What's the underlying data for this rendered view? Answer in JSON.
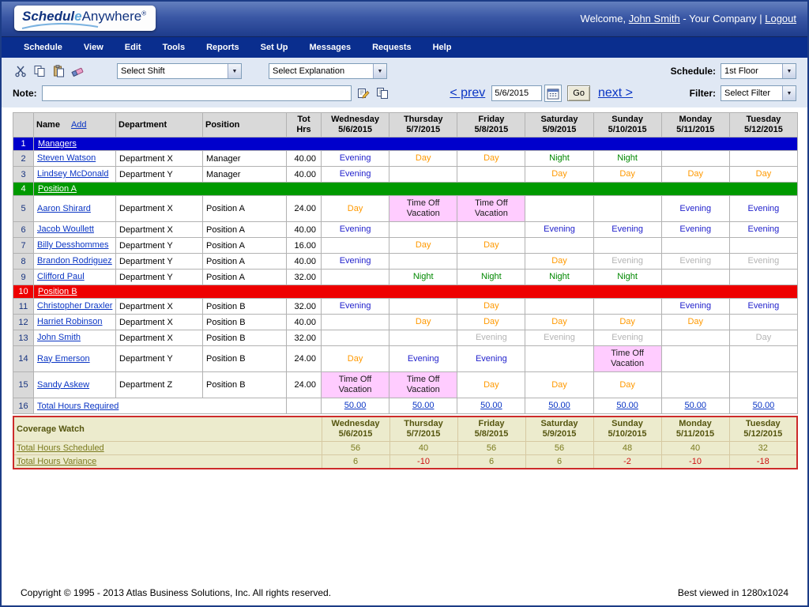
{
  "header": {
    "welcome_prefix": "Welcome,",
    "user_link": "John Smith",
    "company": "- Your Company |",
    "logout": "Logout"
  },
  "logo": {
    "part_main": "Schedul",
    "part_e": "e",
    "part_rest": "Anywhere",
    "reg": "®"
  },
  "menu": [
    "Schedule",
    "View",
    "Edit",
    "Tools",
    "Reports",
    "Set Up",
    "Messages",
    "Requests",
    "Help"
  ],
  "toolbar": {
    "select_shift": "Select Shift",
    "select_explanation": "Select Explanation",
    "schedule_label": "Schedule:",
    "schedule_value": "1st Floor",
    "note_label": "Note:",
    "prev": "< prev",
    "date": "5/6/2015",
    "go": "Go",
    "next": "next >",
    "filter_label": "Filter:",
    "filter_value": "Select Filter"
  },
  "table": {
    "name_header": "Name",
    "add_link": "Add",
    "dept_header": "Department",
    "pos_header": "Position",
    "hrs_header": "Tot Hrs",
    "days": [
      {
        "day": "Wednesday",
        "date": "5/6/2015"
      },
      {
        "day": "Thursday",
        "date": "5/7/2015"
      },
      {
        "day": "Friday",
        "date": "5/8/2015"
      },
      {
        "day": "Saturday",
        "date": "5/9/2015"
      },
      {
        "day": "Sunday",
        "date": "5/10/2015"
      },
      {
        "day": "Monday",
        "date": "5/11/2015"
      },
      {
        "day": "Tuesday",
        "date": "5/12/2015"
      }
    ],
    "rows": [
      {
        "num": "1",
        "type": "group",
        "label": "Managers",
        "color_key": "group_managers"
      },
      {
        "num": "2",
        "type": "person",
        "name": "Steven Watson",
        "dept": "Department X",
        "pos": "Manager",
        "hrs": "40.00",
        "cells": [
          {
            "t": "Evening",
            "s": "ev"
          },
          {
            "t": "Day",
            "s": "day"
          },
          {
            "t": "Day",
            "s": "day"
          },
          {
            "t": "Night",
            "s": "night"
          },
          {
            "t": "Night",
            "s": "night"
          },
          null,
          null
        ]
      },
      {
        "num": "3",
        "type": "person",
        "name": "Lindsey McDonald",
        "dept": "Department Y",
        "pos": "Manager",
        "hrs": "40.00",
        "cells": [
          {
            "t": "Evening",
            "s": "ev"
          },
          null,
          null,
          {
            "t": "Day",
            "s": "day"
          },
          {
            "t": "Day",
            "s": "day"
          },
          {
            "t": "Day",
            "s": "day"
          },
          {
            "t": "Day",
            "s": "day"
          }
        ]
      },
      {
        "num": "4",
        "type": "group",
        "label": "Position A",
        "color_key": "group_position_a"
      },
      {
        "num": "5",
        "type": "person",
        "name": "Aaron Shirard",
        "dept": "Department X",
        "pos": "Position A",
        "hrs": "24.00",
        "cells": [
          {
            "t": "Day",
            "s": "day"
          },
          {
            "t": "Time Off Vacation",
            "s": "vac"
          },
          {
            "t": "Time Off Vacation",
            "s": "vac"
          },
          null,
          null,
          {
            "t": "Evening",
            "s": "ev"
          },
          {
            "t": "Evening",
            "s": "ev"
          }
        ]
      },
      {
        "num": "6",
        "type": "person",
        "name": "Jacob Woullett",
        "dept": "Department X",
        "pos": "Position A",
        "hrs": "40.00",
        "cells": [
          {
            "t": "Evening",
            "s": "ev"
          },
          null,
          null,
          {
            "t": "Evening",
            "s": "ev"
          },
          {
            "t": "Evening",
            "s": "ev"
          },
          {
            "t": "Evening",
            "s": "ev"
          },
          {
            "t": "Evening",
            "s": "ev"
          }
        ]
      },
      {
        "num": "7",
        "type": "person",
        "name": "Billy Desshommes",
        "dept": "Department Y",
        "pos": "Position A",
        "hrs": "16.00",
        "cells": [
          null,
          {
            "t": "Day",
            "s": "day"
          },
          {
            "t": "Day",
            "s": "day"
          },
          null,
          null,
          null,
          null
        ]
      },
      {
        "num": "8",
        "type": "person",
        "name": "Brandon Rodriguez",
        "dept": "Department Y",
        "pos": "Position A",
        "hrs": "40.00",
        "cells": [
          {
            "t": "Evening",
            "s": "ev"
          },
          null,
          null,
          {
            "t": "Day",
            "s": "day"
          },
          {
            "t": "Evening",
            "s": "ev_gray"
          },
          {
            "t": "Evening",
            "s": "ev_gray"
          },
          {
            "t": "Evening",
            "s": "ev_gray"
          }
        ]
      },
      {
        "num": "9",
        "type": "person",
        "name": "Clifford Paul",
        "dept": "Department Y",
        "pos": "Position A",
        "hrs": "32.00",
        "cells": [
          null,
          {
            "t": "Night",
            "s": "night"
          },
          {
            "t": "Night",
            "s": "night"
          },
          {
            "t": "Night",
            "s": "night"
          },
          {
            "t": "Night",
            "s": "night"
          },
          null,
          null
        ]
      },
      {
        "num": "10",
        "type": "group",
        "label": "Position B",
        "color_key": "group_position_b"
      },
      {
        "num": "11",
        "type": "person",
        "name": "Christopher Draxler",
        "dept": "Department X",
        "pos": "Position B",
        "hrs": "32.00",
        "cells": [
          {
            "t": "Evening",
            "s": "ev"
          },
          null,
          {
            "t": "Day",
            "s": "day"
          },
          null,
          null,
          {
            "t": "Evening",
            "s": "ev"
          },
          {
            "t": "Evening",
            "s": "ev"
          }
        ]
      },
      {
        "num": "12",
        "type": "person",
        "name": "Harriet Robinson",
        "dept": "Department X",
        "pos": "Position B",
        "hrs": "40.00",
        "cells": [
          null,
          {
            "t": "Day",
            "s": "day"
          },
          {
            "t": "Day",
            "s": "day"
          },
          {
            "t": "Day",
            "s": "day"
          },
          {
            "t": "Day",
            "s": "day"
          },
          {
            "t": "Day",
            "s": "day"
          },
          null
        ]
      },
      {
        "num": "13",
        "type": "person",
        "name": "John Smith",
        "dept": "Department X",
        "pos": "Position B",
        "hrs": "32.00",
        "cells": [
          null,
          null,
          {
            "t": "Evening",
            "s": "ev_gray"
          },
          {
            "t": "Evening",
            "s": "ev_gray"
          },
          {
            "t": "Evening",
            "s": "ev_gray"
          },
          null,
          {
            "t": "Day",
            "s": "day_gray"
          }
        ]
      },
      {
        "num": "14",
        "type": "person",
        "name": "Ray Emerson",
        "dept": "Department Y",
        "pos": "Position B",
        "hrs": "24.00",
        "cells": [
          {
            "t": "Day",
            "s": "day"
          },
          {
            "t": "Evening",
            "s": "ev"
          },
          {
            "t": "Evening",
            "s": "ev"
          },
          null,
          {
            "t": "Time Off Vacation",
            "s": "vac"
          },
          null,
          null
        ]
      },
      {
        "num": "15",
        "type": "person",
        "name": "Sandy Askew",
        "dept": "Department Z",
        "pos": "Position B",
        "hrs": "24.00",
        "cells": [
          {
            "t": "Time Off Vacation",
            "s": "vac"
          },
          {
            "t": "Time Off Vacation",
            "s": "vac"
          },
          {
            "t": "Day",
            "s": "day"
          },
          {
            "t": "Day",
            "s": "day"
          },
          {
            "t": "Day",
            "s": "day"
          },
          null,
          null
        ]
      },
      {
        "num": "16",
        "type": "total",
        "label": "Total Hours Required",
        "values": [
          "50.00",
          "50.00",
          "50.00",
          "50.00",
          "50.00",
          "50.00",
          "50.00"
        ]
      }
    ]
  },
  "coverage": {
    "title": "Coverage Watch",
    "rows": [
      {
        "label": "Total Hours Scheduled",
        "values": [
          "56",
          "40",
          "56",
          "56",
          "48",
          "40",
          "32"
        ]
      },
      {
        "label": "Total Hours Variance",
        "values": [
          "6",
          "-10",
          "6",
          "6",
          "-2",
          "-10",
          "-18"
        ]
      }
    ]
  },
  "footer": {
    "copyright": "Copyright © 1995 - 2013 Atlas Business Solutions, Inc. All rights reserved.",
    "best_viewed": "Best viewed in 1280x1024"
  },
  "colors": {
    "evening": "#2222cc",
    "day": "#ff9900",
    "night": "#008800",
    "inactive": "#b4b4b4",
    "vacation_bg": "#ffccff",
    "group_managers": "#0000cc",
    "group_position_a": "#009900",
    "group_position_b": "#ee0000",
    "negative": "#cc1111"
  }
}
